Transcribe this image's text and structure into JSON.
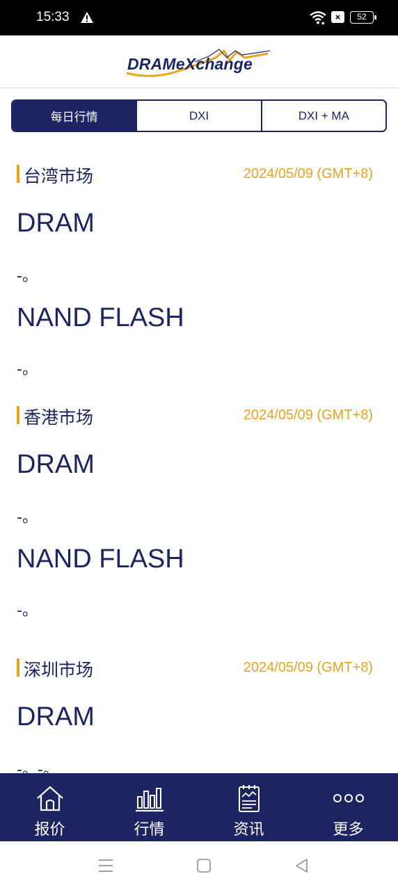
{
  "status_bar": {
    "time": "15:33",
    "sim_badge": "×",
    "battery": "52"
  },
  "header": {
    "logo_text": "DRAMeXchange",
    "colors": {
      "brand": "#1c2562",
      "accent": "#e8a31f"
    }
  },
  "tabs": [
    {
      "label": "每日行情",
      "active": true
    },
    {
      "label": "DXI",
      "active": false
    },
    {
      "label": "DXI + MA",
      "active": false
    }
  ],
  "markets": [
    {
      "title": "台湾市场",
      "date": "2024/05/09 (GMT+8)",
      "products": [
        {
          "name": "DRAM",
          "value": "-。"
        },
        {
          "name": "NAND FLASH",
          "value": "-。"
        }
      ]
    },
    {
      "title": "香港市场",
      "date": "2024/05/09 (GMT+8)",
      "products": [
        {
          "name": "DRAM",
          "value": "-。"
        },
        {
          "name": "NAND FLASH",
          "value": "-。"
        }
      ]
    },
    {
      "title": "深圳市场",
      "date": "2024/05/09 (GMT+8)",
      "products": [
        {
          "name": "DRAM",
          "value": "-。-。"
        }
      ]
    }
  ],
  "bottom_nav": [
    {
      "label": "报价",
      "icon": "home-icon"
    },
    {
      "label": "行情",
      "icon": "bar-chart-icon"
    },
    {
      "label": "资讯",
      "icon": "news-icon"
    },
    {
      "label": "更多",
      "icon": "more-icon"
    }
  ],
  "system_nav": [
    "menu-icon",
    "home-square-icon",
    "back-icon"
  ]
}
